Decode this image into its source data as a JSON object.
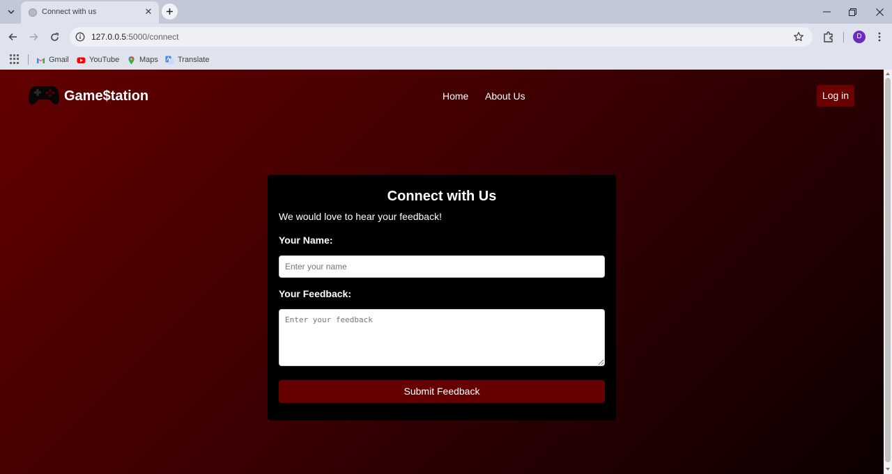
{
  "browser": {
    "tab": {
      "title": "Connect with us",
      "close_glyph": "✕",
      "favicon": "globe-icon"
    },
    "new_tab_glyph": "+",
    "url": {
      "host": "127.0.0.5",
      "path": ":5000/connect"
    },
    "profile_initial": "D",
    "bookmarks": [
      {
        "label": "Gmail",
        "icon": "gmail-icon",
        "color": "#ea4335"
      },
      {
        "label": "YouTube",
        "icon": "youtube-icon",
        "color": "#ff0000"
      },
      {
        "label": "Maps",
        "icon": "maps-icon",
        "color": "#34a853"
      },
      {
        "label": "Translate",
        "icon": "translate-icon",
        "color": "#4285f4"
      }
    ],
    "colors": {
      "tabstrip": "#c3c8d8",
      "toolbar": "#dfe3ee",
      "profile": "#6a2bc3"
    }
  },
  "site": {
    "brand": "Game$tation",
    "logo_icon": "gamepad-icon",
    "nav": [
      {
        "label": "Home"
      },
      {
        "label": "About Us"
      }
    ],
    "login_label": "Log in",
    "colors": {
      "accent": "#650000",
      "bg_start": "#630000",
      "bg_end": "#0c0001",
      "card": "#000000"
    }
  },
  "form": {
    "title": "Connect with Us",
    "subtitle": "We would love to hear your feedback!",
    "name_label": "Your Name:",
    "name_placeholder": "Enter your name",
    "name_value": "",
    "feedback_label": "Your Feedback:",
    "feedback_placeholder": "Enter your feedback",
    "feedback_value": "",
    "submit_label": "Submit Feedback"
  }
}
